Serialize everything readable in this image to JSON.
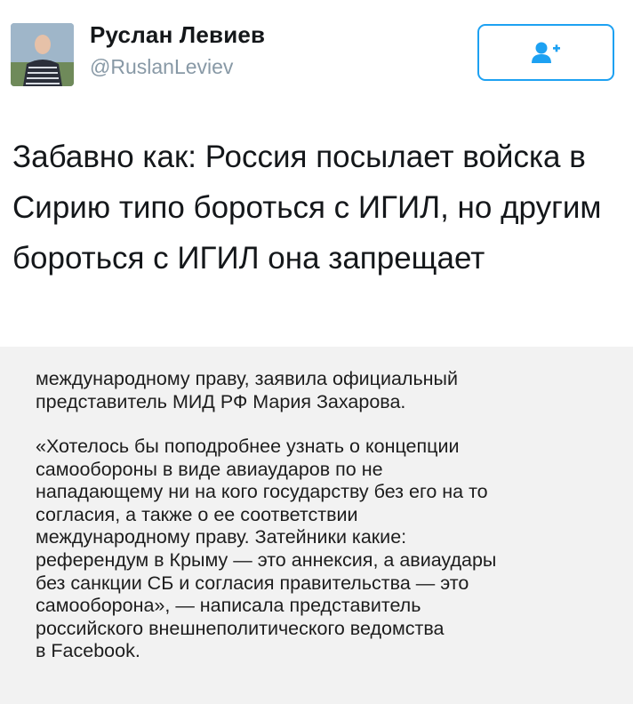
{
  "tweet": {
    "author_name": "Руслан Левиев",
    "author_handle": "@RuslanLeviev",
    "text": "Забавно как: Россия посылает войска в Сирию типо бороться с ИГИЛ, но другим бороться с ИГИЛ она запрещает",
    "follow_icon": "add-user-icon",
    "accent_color": "#1da1f2"
  },
  "media": {
    "paragraphs": [
      "международному праву, заявила официальный\nпредставитель МИД РФ Мария Захарова.",
      "«Хотелось бы поподробнее узнать о концепции\nсамообороны в виде авиаударов по не\nнападающему ни на кого государству без его на то\nсогласия, а также о ее соответствии\nмеждународному праву. Затейники какие:\nреферендум в Крыму — это аннексия, а авиаудары\nбез санкции СБ и согласия правительства — это\nсамооборона», — написала представитель\nроссийского внешнеполитического ведомства\nв Facebook."
    ]
  }
}
